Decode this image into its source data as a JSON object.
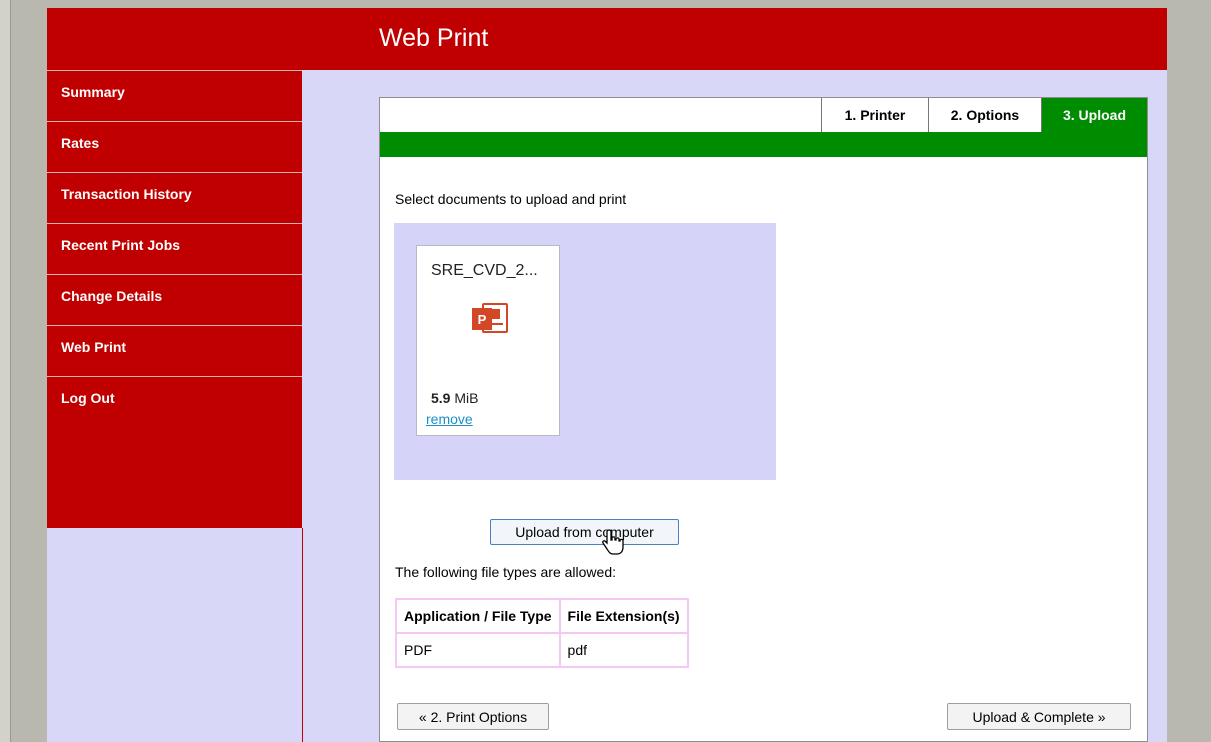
{
  "header": {
    "title": "Web Print"
  },
  "sidebar": {
    "items": [
      {
        "label": "Summary"
      },
      {
        "label": "Rates"
      },
      {
        "label": "Transaction History"
      },
      {
        "label": "Recent Print Jobs"
      },
      {
        "label": "Change Details"
      },
      {
        "label": "Web Print"
      },
      {
        "label": "Log Out"
      }
    ]
  },
  "wizard": {
    "tabs": [
      {
        "label": "1. Printer"
      },
      {
        "label": "2. Options"
      },
      {
        "label": "3. Upload"
      }
    ],
    "active_tab": "3. Upload"
  },
  "upload": {
    "instructions": "Select documents to upload and print",
    "file": {
      "name": "SRE_CVD_2...",
      "size_value": "5.9",
      "size_unit": "MiB",
      "remove_label": "remove",
      "icon": "powerpoint-icon"
    },
    "upload_button": "Upload from computer",
    "filetypes_label": "The following file types are allowed:",
    "table": {
      "headers": [
        "Application / File Type",
        "File Extension(s)"
      ],
      "rows": [
        [
          "PDF",
          "pdf"
        ]
      ]
    }
  },
  "nav": {
    "back_button": "« 2. Print Options",
    "complete_button": "Upload & Complete »"
  },
  "colors": {
    "brand_red": "#c00000",
    "step_green": "#008c00",
    "page_lavender": "#d9d7f7",
    "link_blue": "#1a8fc8"
  }
}
